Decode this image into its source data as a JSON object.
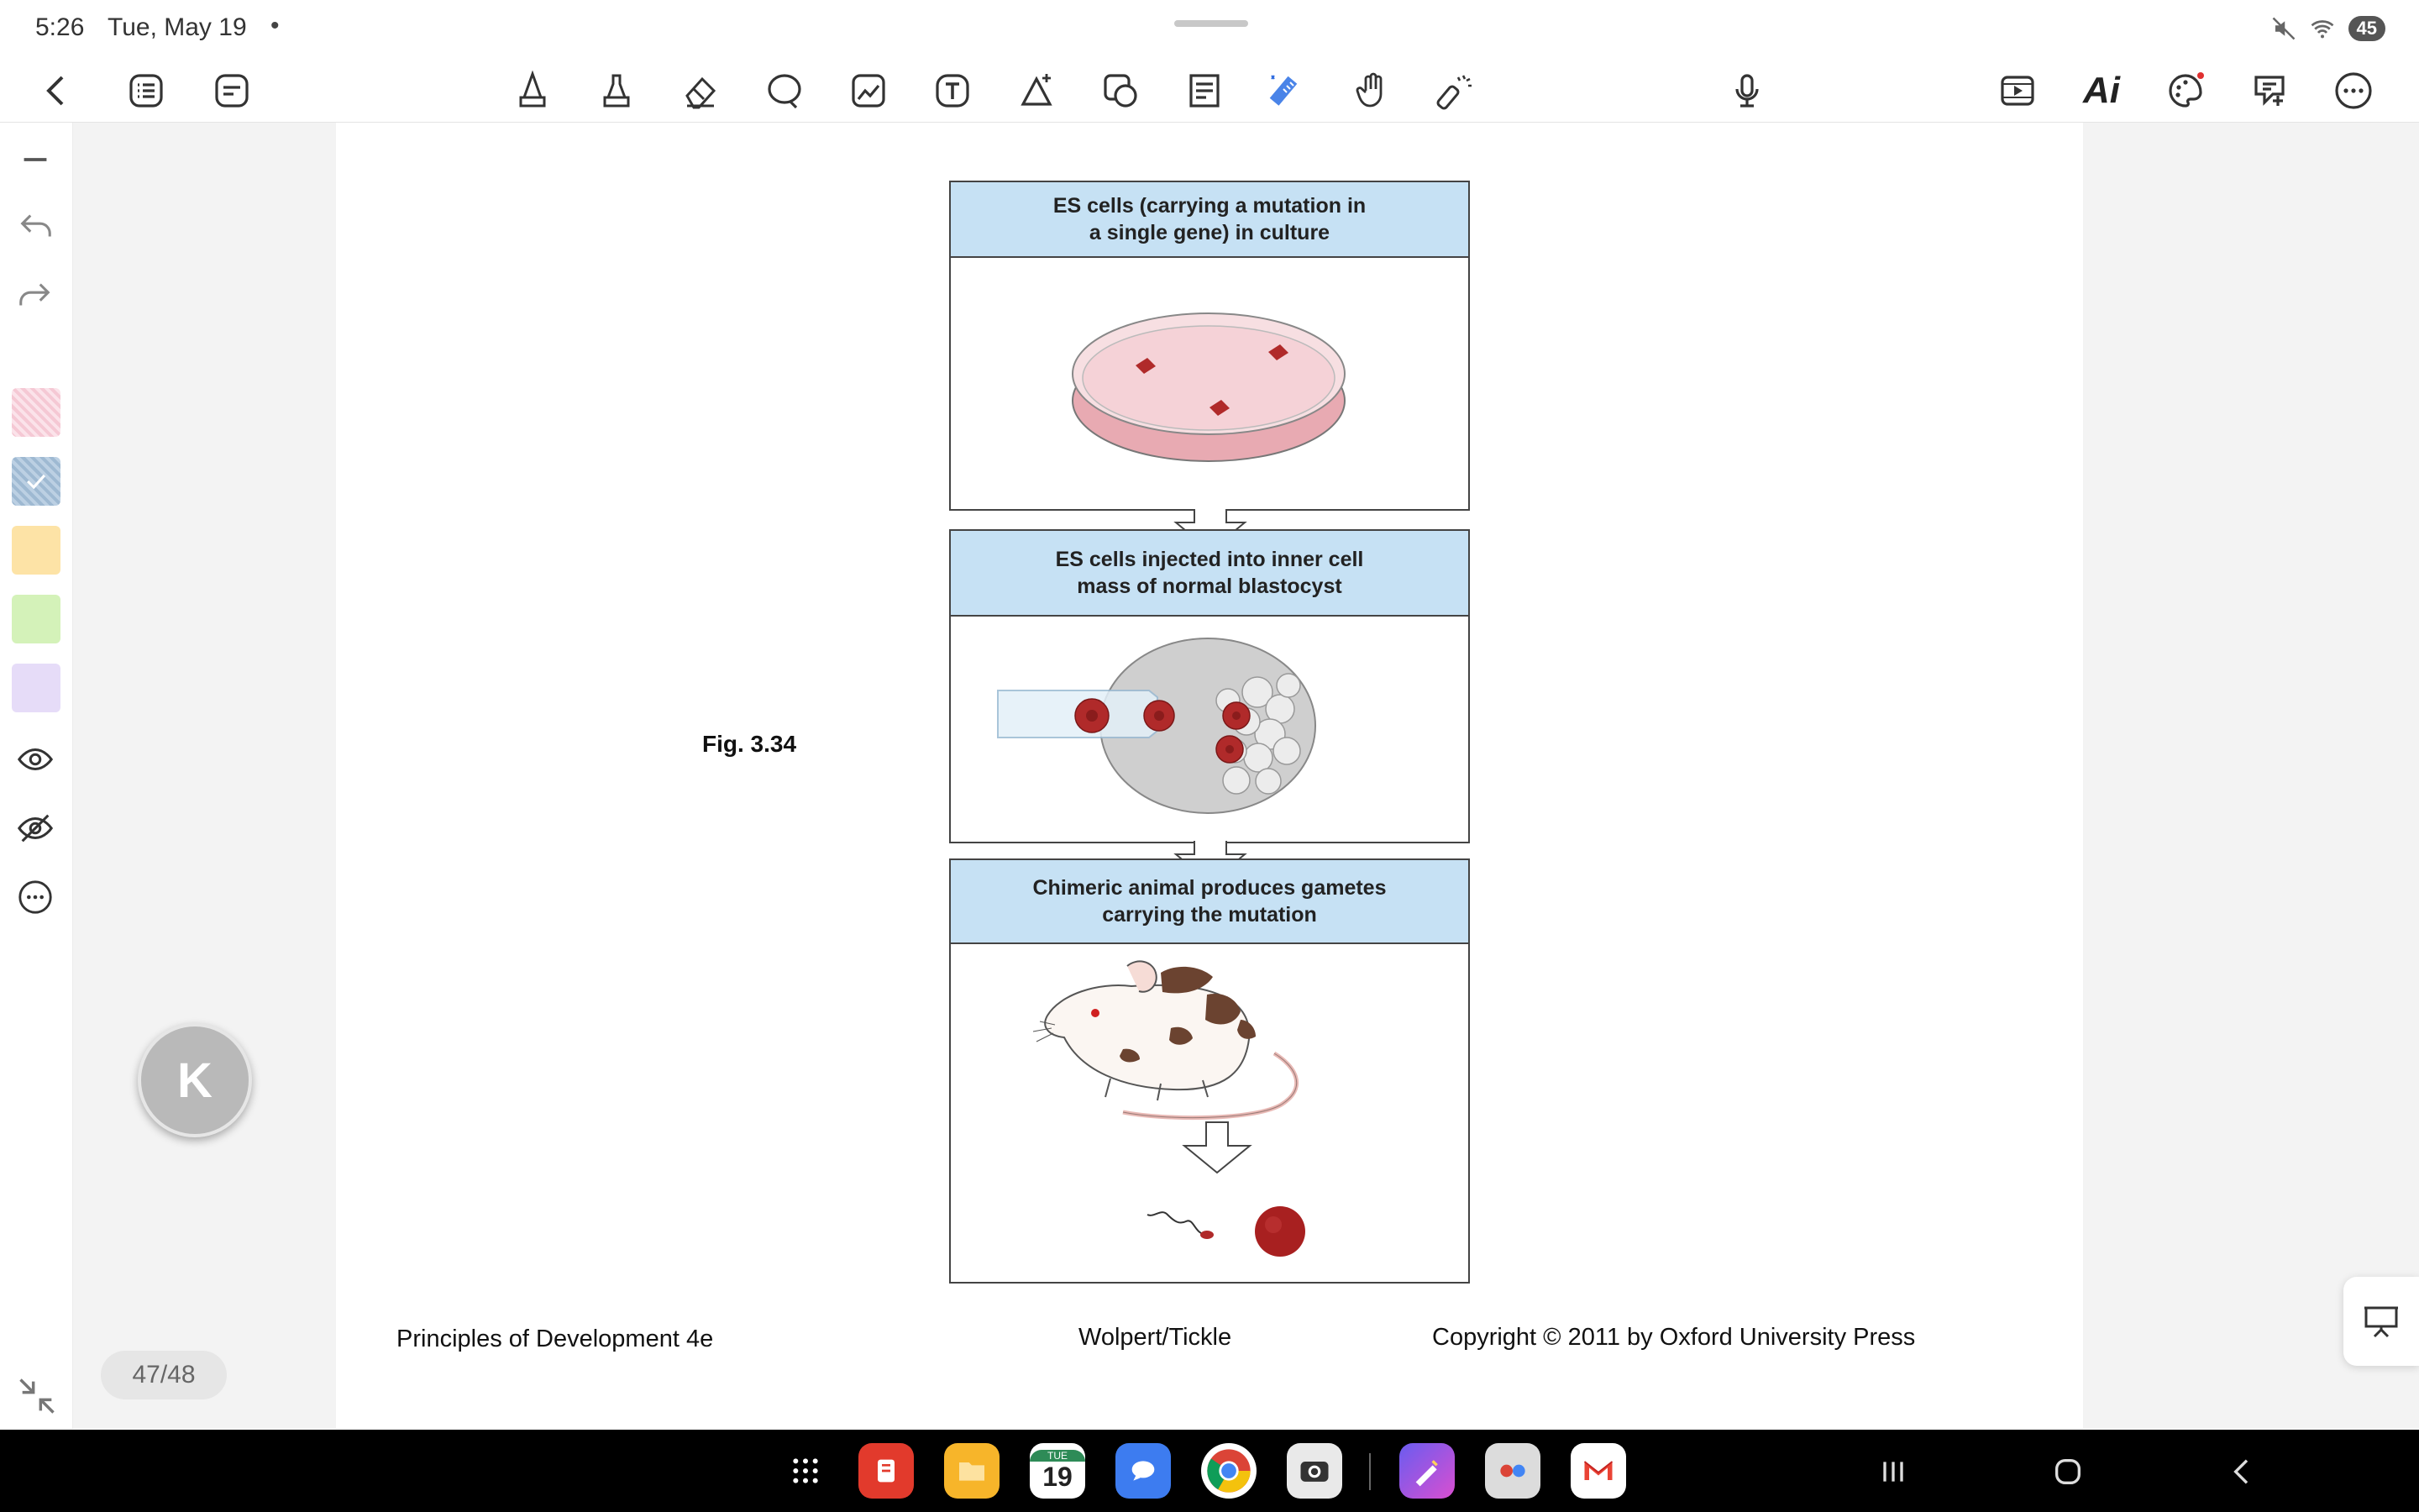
{
  "status_bar": {
    "time": "5:26",
    "date": "Tue, May 19",
    "dot": "•",
    "battery": "45",
    "icons": [
      "mute-icon",
      "wifi-icon",
      "battery-icon"
    ]
  },
  "toolbar": {
    "left_icons": [
      "back-icon",
      "list-icon",
      "page-view-icon"
    ],
    "center_icons": [
      "pen-icon",
      "highlighter-icon",
      "eraser-icon",
      "lasso-icon",
      "image-icon",
      "text-icon",
      "shape-icon",
      "sticker-icon",
      "template-icon",
      "ruler-icon",
      "hand-icon",
      "laser-pointer-icon"
    ],
    "mic_icon": "microphone-icon",
    "ai_label": "Ai",
    "right_icons": [
      "video-icon",
      "ai-icon",
      "palette-icon",
      "add-note-icon",
      "more-icon"
    ]
  },
  "left_rail": {
    "icons": [
      "minimize-icon",
      "undo-icon",
      "redo-icon",
      "eye-icon",
      "eye-off-icon",
      "more-icon"
    ],
    "swatches": [
      "#f7d3dd",
      "#aac3d9",
      "#fde3a6",
      "#d4f2b9",
      "#e6dcf8"
    ]
  },
  "document": {
    "fig_label": "Fig. 3.34",
    "panels": [
      {
        "heading_line1": "ES cells (carrying a mutation in",
        "heading_line2": "a single gene) in culture"
      },
      {
        "heading_line1": "ES cells injected into inner cell",
        "heading_line2": "mass of normal blastocyst"
      },
      {
        "heading_line1": "Chimeric animal produces gametes",
        "heading_line2": "carrying the mutation"
      }
    ],
    "footer_left": "Principles of Development 4e",
    "footer_center": "Wolpert/Tickle",
    "footer_right": "Copyright © 2011 by Oxford University Press"
  },
  "overlay": {
    "k_button_label": "K",
    "page_counter": "47/48"
  },
  "navbar": {
    "calendar_day_top": "TUE",
    "calendar_day": "19",
    "apps": [
      "app-drawer-icon",
      "notes-app-icon",
      "files-app-icon",
      "calendar-app-icon",
      "messages-app-icon",
      "chrome-app-icon",
      "camera-app-icon",
      "paint-app-icon",
      "multi-app-icon",
      "gmail-app-icon"
    ],
    "keys": [
      "recents-key",
      "home-key",
      "back-key"
    ]
  },
  "colors": {
    "panel_header": "#c6e1f4",
    "cell_red": "#b02a2a",
    "dock_bg": "#000000"
  }
}
